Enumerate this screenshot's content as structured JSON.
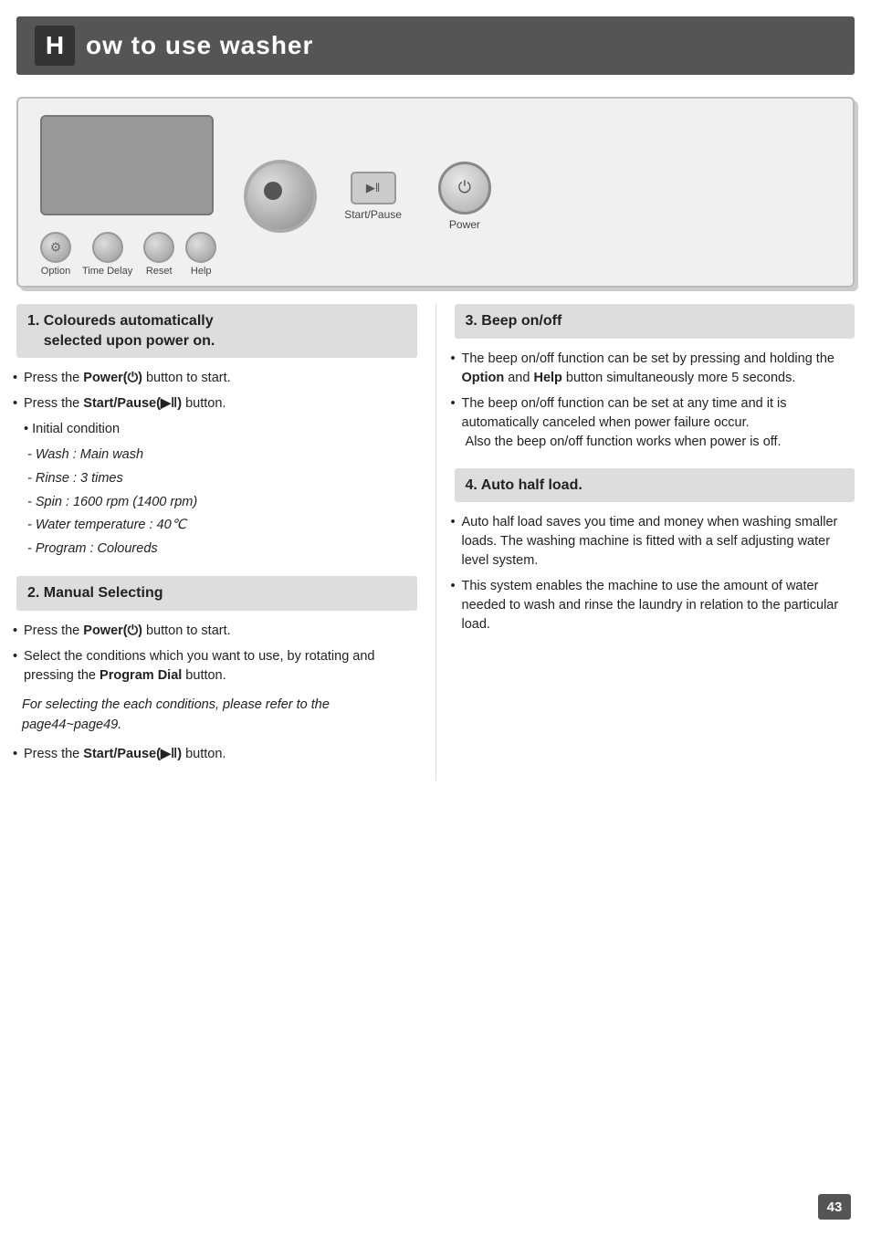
{
  "header": {
    "letter": "H",
    "title": "ow to use washer"
  },
  "panel": {
    "startpause_label": "Start/Pause",
    "power_label": "Power",
    "buttons": [
      {
        "label": "Option"
      },
      {
        "label": "Time Delay"
      },
      {
        "label": "Reset"
      },
      {
        "label": "Help"
      }
    ]
  },
  "section1": {
    "title": "1. Coloureds automatically\n    selected upon power on.",
    "bullets": [
      {
        "text": "Press the ",
        "bold": "Power(⏻)",
        "rest": " button to start."
      },
      {
        "text": "Press the ",
        "bold": "Start/Pause(▶‖)",
        "rest": " button."
      },
      {
        "text": "Initial condition",
        "plain": true
      },
      {
        "italic": true,
        "text": "- Wash :  Main wash"
      },
      {
        "italic": true,
        "text": "- Rinse : 3 times"
      },
      {
        "italic": true,
        "text": "- Spin : 1600 rpm (1400 rpm)"
      },
      {
        "italic": true,
        "text": "- Water temperature : 40℃"
      },
      {
        "italic": true,
        "text": "- Program : Coloureds"
      }
    ]
  },
  "section2": {
    "title": "2. Manual Selecting",
    "bullets": [
      {
        "text": "Press the ",
        "bold": "Power(⏻)",
        "rest": " button to start."
      },
      {
        "text": "Select the conditions which you want to use, by rotating and pressing the ",
        "bold": "Program Dial",
        "rest": " button."
      },
      {
        "italic_block": true,
        "text": "For selecting the each conditions, please refer to the page44~page49."
      },
      {
        "text": "Press the ",
        "bold": "Start/Pause(▶‖)",
        "rest": " button."
      }
    ]
  },
  "section3": {
    "title": "3. Beep on/off",
    "bullets": [
      {
        "text": "The beep on/off function can be set by pressing and holding the ",
        "bold": "Option",
        "rest": " and ",
        "bold2": "Help",
        "rest2": " button simultaneously more 5 seconds."
      },
      {
        "text": "The beep on/off function can be set at any time and it is automatically canceled when power failure occur.\n Also the beep on/off function works when power is off."
      }
    ]
  },
  "section4": {
    "title": "4. Auto half load.",
    "bullets": [
      {
        "text": "Auto half load saves you time and money when washing smaller loads. The washing machine is fitted with a self adjusting water level system."
      },
      {
        "text": "This system enables the machine to use the amount of water needed to wash and rinse the laundry in relation to the particular load."
      }
    ]
  },
  "page_number": "43"
}
